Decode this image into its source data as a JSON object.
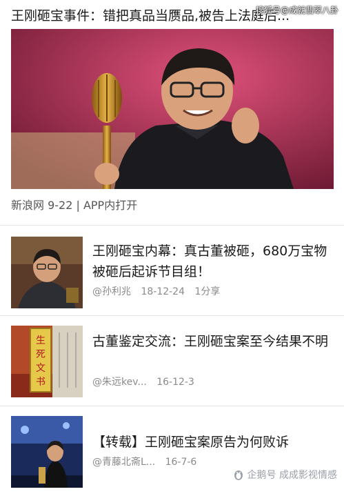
{
  "top_article": {
    "title": "王刚砸宝事件：错把真品当赝品,被告上法庭后...",
    "source": "新浪网 9-22 | APP内打开",
    "watermark": "搜狐号@成就翡翠八卦"
  },
  "articles": [
    {
      "title": "王刚砸宝内幕：真古董被砸，680万宝物被砸后起诉节目组！",
      "author": "@孙利兆",
      "date": "18-12-24",
      "shares": "1分享"
    },
    {
      "title": "古董鉴定交流：王刚砸宝案至今结果不明",
      "author": "@朱远kev...",
      "date": "16-12-3",
      "shares": ""
    },
    {
      "title": "【转载】王刚砸宝案原告为何败诉",
      "author": "@青藤北斋L...",
      "date": "16-7-6",
      "shares": ""
    }
  ],
  "thumb_text": "生死文书",
  "bottom_watermark": {
    "icon": "penguin-icon",
    "text": "企鹅号 成成影视情感"
  }
}
